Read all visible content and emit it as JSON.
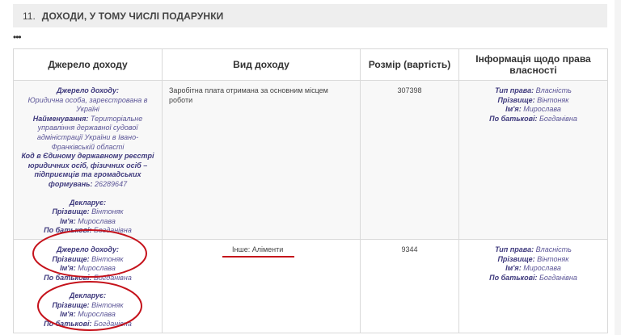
{
  "section": {
    "number": "11.",
    "title": "ДОХОДИ, У ТОМУ ЧИСЛІ ПОДАРУНКИ"
  },
  "ellipsis": "•••",
  "table": {
    "headers": {
      "source": "Джерело доходу",
      "kind": "Вид доходу",
      "amount": "Розмір (вартість)",
      "ownership": "Інформація щодо права власності"
    },
    "rows": [
      {
        "source": {
          "label_source": "Джерело доходу:",
          "entity_type": "Юридична особа, зареєстрована в Україні",
          "label_name": "Найменування:",
          "name": "Територіальне управління державної судової адміністрації України в Івано-Франківській області",
          "label_code": "Код в Єдиному державному реєстрі юридичних осіб, фізичних осіб – підприємців та громадських формувань:",
          "code": "26289647",
          "declarant_label": "Декларує:",
          "surname_label": "Прізвище:",
          "surname": "Вінтоняк",
          "firstname_label": "Ім'я:",
          "firstname": "Мирослава",
          "patronymic_label": "По батькові:",
          "patronymic": "Богданівна"
        },
        "kind": "Заробітна плата отримана за основним місцем роботи",
        "amount": "307398",
        "ownership": {
          "right_label": "Тип права:",
          "right": "Власність",
          "surname_label": "Прізвище:",
          "surname": "Вінтоняк",
          "firstname_label": "Ім'я:",
          "firstname": "Мирослава",
          "patronymic_label": "По батькові:",
          "patronymic": "Богданівна"
        }
      },
      {
        "source": {
          "label_source": "Джерело доходу:",
          "surname_label": "Прізвище:",
          "surname": "Вінтоняк",
          "firstname_label": "Ім'я:",
          "firstname": "Мирослава",
          "patronymic_label": "По батькові:",
          "patronymic": "Богданівна",
          "declarant_label": "Декларує:",
          "d_surname_label": "Прізвище:",
          "d_surname": "Вінтоняк",
          "d_firstname_label": "Ім'я:",
          "d_firstname": "Мирослава",
          "d_patronymic_label": "По батькові:",
          "d_patronymic": "Богданівна"
        },
        "kind": "Інше: Аліменти",
        "amount": "9344",
        "ownership": {
          "right_label": "Тип права:",
          "right": "Власність",
          "surname_label": "Прізвище:",
          "surname": "Вінтоняк",
          "firstname_label": "Ім'я:",
          "firstname": "Мирослава",
          "patronymic_label": "По батькові:",
          "patronymic": "Богданівна"
        }
      }
    ]
  },
  "colors": {
    "label_text": "#3f3a7d",
    "value_text": "#5b5597",
    "annotation_red": "#c5121b",
    "header_bg": "#eeeeee"
  }
}
